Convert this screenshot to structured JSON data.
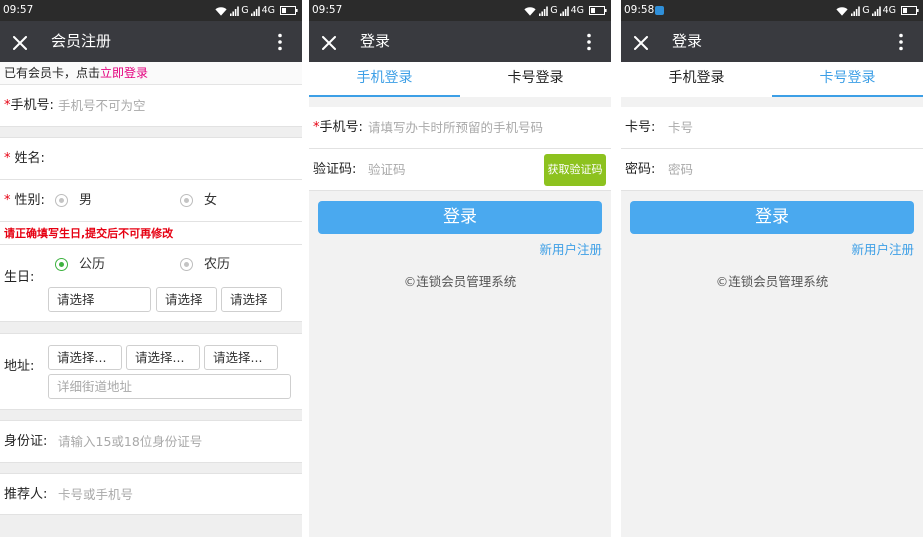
{
  "colors": {
    "status_bar": "#2b2b2b",
    "title_bar": "#393a3f",
    "login_button_blue": "#4aa9ef",
    "link_blue": "#3d9fe6",
    "code_button_green": "#8dc21f",
    "login_link_pink": "#e4007f",
    "required_red": "#e60012",
    "radio_checked_green": "#3db23f",
    "notification_blue": "#2f8fd8"
  },
  "register_screen": {
    "status": {
      "time": "09:57",
      "network_1": "G",
      "network_2": "4G"
    },
    "titlebar": {
      "title": "会员注册",
      "close_icon": "close-icon",
      "menu_icon": "more-vertical-icon"
    },
    "prompt": {
      "text": "已有会员卡，点击",
      "link": "立即登录"
    },
    "phone": {
      "required": "*",
      "label": "手机号:",
      "placeholder": "手机号不可为空"
    },
    "name": {
      "required": "*",
      "label": "姓名:"
    },
    "gender": {
      "required": "*",
      "label": "性别:",
      "options": [
        "男",
        "女"
      ]
    },
    "birthday_warning": "请正确填写生日,提交后不可再修改",
    "birthday": {
      "label": "生日:",
      "calendar_options": [
        "公历",
        "农历"
      ],
      "selected_index": 0,
      "selects": [
        "请选择",
        "请选择",
        "请选择"
      ]
    },
    "address": {
      "label": "地址:",
      "selects": [
        "请选择...",
        "请选择...",
        "请选择..."
      ],
      "street_placeholder": "详细街道地址"
    },
    "id_card": {
      "label": "身份证:",
      "placeholder": "请输入15或18位身份证号"
    },
    "referrer": {
      "label": "推荐人:",
      "placeholder": "卡号或手机号"
    }
  },
  "phone_login_screen": {
    "status": {
      "time": "09:57",
      "network_1": "G",
      "network_2": "4G"
    },
    "titlebar": {
      "title": "登录",
      "close_icon": "close-icon",
      "menu_icon": "more-vertical-icon"
    },
    "tabs": [
      "手机登录",
      "卡号登录"
    ],
    "active_tab": 0,
    "phone": {
      "required": "*",
      "label": "手机号:",
      "placeholder": "请填写办卡时所预留的手机号码"
    },
    "code": {
      "label": "验证码:",
      "placeholder": "验证码",
      "button": "获取验证码"
    },
    "login_button": "登录",
    "register_link": "新用户注册",
    "footer": "©连锁会员管理系统"
  },
  "card_login_screen": {
    "status": {
      "time": "09:58",
      "network_1": "G",
      "network_2": "4G",
      "notification_icon": "notification-icon"
    },
    "titlebar": {
      "title": "登录",
      "close_icon": "close-icon",
      "menu_icon": "more-vertical-icon"
    },
    "tabs": [
      "手机登录",
      "卡号登录"
    ],
    "active_tab": 1,
    "card": {
      "label": "卡号:",
      "placeholder": "卡号"
    },
    "password": {
      "label": "密码:",
      "placeholder": "密码"
    },
    "login_button": "登录",
    "register_link": "新用户注册",
    "footer": "©连锁会员管理系统"
  }
}
